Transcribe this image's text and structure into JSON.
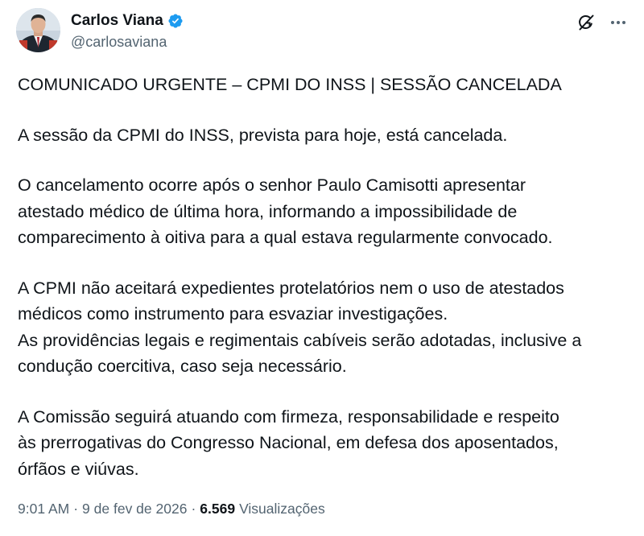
{
  "author": {
    "display_name": "Carlos Viana",
    "handle": "@carlosaviana",
    "verified_color": "#1d9bf0"
  },
  "icons": {
    "verified": "verified-badge-icon",
    "grok": "grok-icon",
    "more": "more-options-icon"
  },
  "tweet": {
    "paragraphs": [
      "COMUNICADO URGENTE – CPMI DO INSS | SESSÃO CANCELADA",
      "A sessão da CPMI do INSS, prevista para hoje, está cancelada.",
      "O cancelamento ocorre após o senhor Paulo Camisotti apresentar\natestado médico de última hora, informando a impossibilidade de\ncomparecimento à oitiva para a qual estava regularmente convocado.",
      "A CPMI não aceitará expedientes protelatórios nem o uso de atestados\nmédicos como instrumento para esvaziar investigações.\nAs providências legais e regimentais cabíveis serão adotadas, inclusive a\ncondução coercitiva, caso seja necessário.",
      "A Comissão seguirá atuando com firmeza, responsabilidade e respeito\nàs prerrogativas do Congresso Nacional, em defesa dos aposentados,\nórfãos e viúvas."
    ]
  },
  "meta": {
    "time": "9:01 AM",
    "separator1": "·",
    "date": "9 de fev de 2026",
    "separator2": "·",
    "views_count": "6.569",
    "views_label": "Visualizações"
  }
}
